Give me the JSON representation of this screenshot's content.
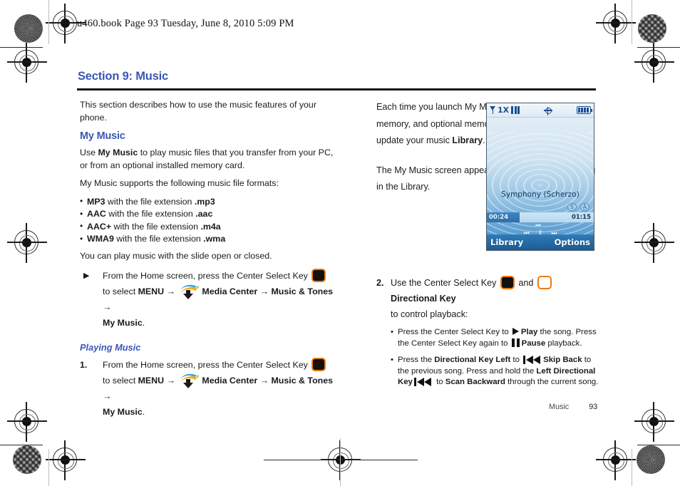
{
  "book_header": "u460.book  Page 93  Tuesday, June 8, 2010  5:09 PM",
  "section_title": "Section 9: Music",
  "left_column": {
    "intro": "This section describes how to use the music features of your phone.",
    "my_music_heading": "My Music",
    "my_music_p1_pre": "Use ",
    "my_music_p1_bold": "My Music",
    "my_music_p1_post": "  to play music files that you transfer from your PC, or from an optional installed memory card.",
    "formats_intro": "My Music supports the following music file formats:",
    "formats": [
      {
        "name": "MP3",
        "mid": " with the file extension ",
        "ext": ".mp3"
      },
      {
        "name": "AAC",
        "mid": " with the file extension ",
        "ext": ".aac"
      },
      {
        "name": "AAC+",
        "mid": " with the file extension ",
        "ext": ".m4a"
      },
      {
        "name": "WMA9",
        "mid": " with the file extension ",
        "ext": ".wma"
      }
    ],
    "slide_note": "You can play music with the slide open or closed.",
    "nav_step_arrow": {
      "marker": "▶",
      "lead": "From the Home screen, press the Center Select Key",
      "select_word": "to select ",
      "menu": "MENU",
      "arrow": "→",
      "media_center": "Media Center",
      "music_tones": "Music & Tones",
      "my_music": "My Music",
      "period": "."
    },
    "playing_music_heading": "Playing Music",
    "nav_step_1": {
      "marker": "1.",
      "lead": "From the Home screen, press the Center Select Key",
      "select_word": "to select ",
      "menu": "MENU",
      "arrow": "→",
      "media_center": "Media Center",
      "music_tones": "Music & Tones",
      "my_music": "My Music",
      "period": "."
    }
  },
  "right_column": {
    "p1_pre": "Each time you launch My Music, it checks your phone memory, and optional memory card, for music files to update your music ",
    "p1_bold": "Library",
    "p1_post": ".",
    "p2": "The My Music screen appears, displaying the first song in the Library.",
    "step_2": {
      "marker": "2.",
      "lead": "Use the Center Select Key",
      "and": "and",
      "dir_key_label": "Directional Key",
      "tail": "to control playback:",
      "bullets": [
        {
          "seg1": "Press the Center Select Key to ",
          "play_bold": "Play",
          "seg2": " the song. Press the Center Select Key again to ",
          "pause_bold": "Pause",
          "seg3": " playback."
        },
        {
          "seg1": "Press the ",
          "b1": "Directional Key Left",
          "seg2": " to ",
          "b2": "Skip Back",
          "seg3": " to the previous song. Press and hold the ",
          "b3": "Left Directional Key",
          "seg4": " to ",
          "b4": "Scan Backward",
          "seg5": " through the current song."
        }
      ]
    }
  },
  "phone_screen": {
    "status": {
      "network": "1X",
      "signal_icon": "antenna-icon",
      "gps_icon": "gps-icon",
      "battery_icon": "battery-icon"
    },
    "song_title": "Symphony (Scherzo)",
    "caps": [
      "S",
      "A"
    ],
    "elapsed": "00:24",
    "total": "01:15",
    "repeat_label": "↺",
    "controls": [
      "⏮",
      "‖",
      "⏭"
    ],
    "softkey_left": "Library",
    "softkey_right": "Options"
  },
  "footer": {
    "chapter": "Music",
    "page": "93"
  }
}
